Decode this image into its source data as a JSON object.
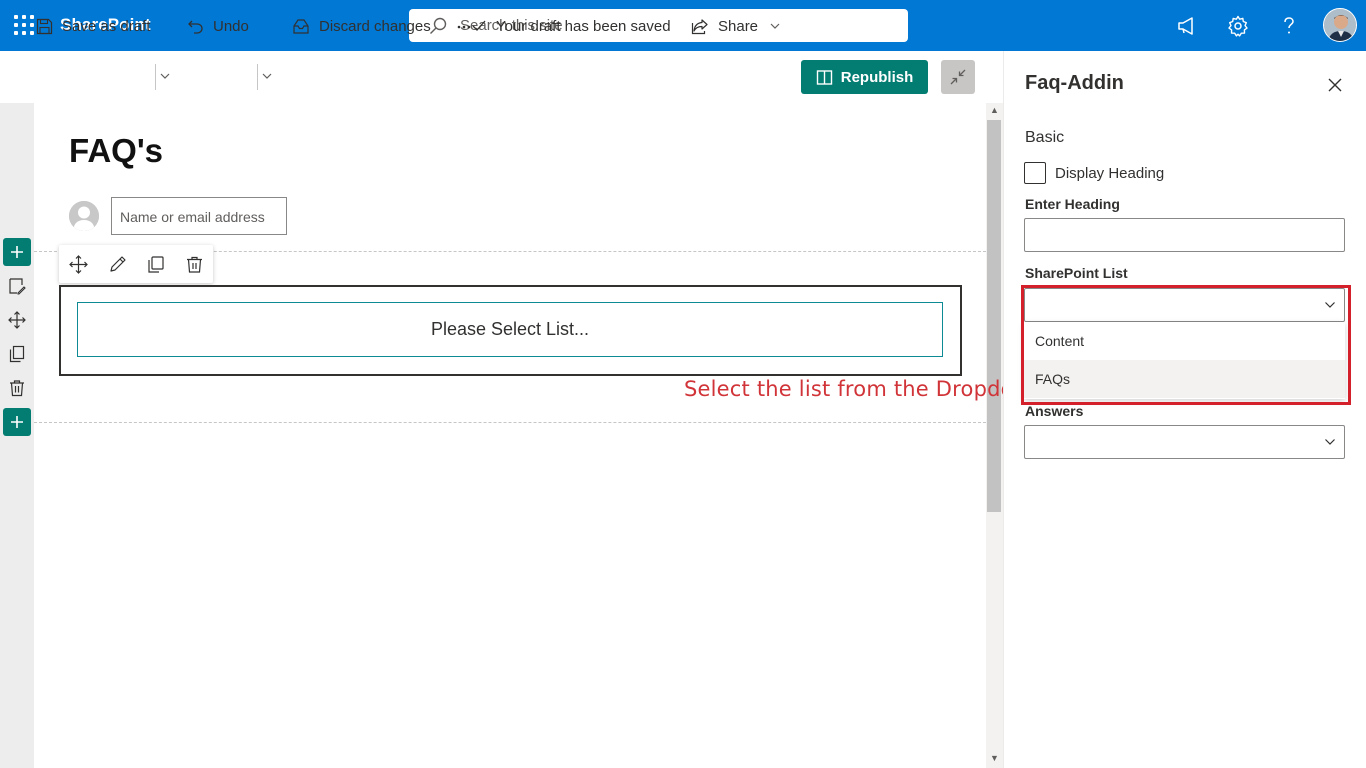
{
  "suitebar": {
    "brand": "SharePoint",
    "search_placeholder": "Search this site",
    "icons": [
      "waffle-icon",
      "search-icon",
      "megaphone-icon",
      "settings-gear-icon",
      "help-question-icon",
      "user-avatar"
    ],
    "accent": "#0078d4"
  },
  "commandbar": {
    "save_draft": "Save as draft",
    "undo": "Undo",
    "discard": "Discard changes",
    "status": "Your draft has been saved",
    "share": "Share",
    "republish": "Republish",
    "republish_color": "#037c72"
  },
  "page": {
    "title": "FAQ's",
    "author_placeholder": "Name or email address",
    "webpart_message": "Please Select List...",
    "annotation": "Select the list from the Dropdown",
    "annotation_color": "#d13438"
  },
  "pane": {
    "title": "Faq-Addin",
    "group": "Basic",
    "display_heading": "Display Heading",
    "display_heading_checked": false,
    "enter_heading_label": "Enter Heading",
    "enter_heading_value": "",
    "list_label": "SharePoint List",
    "list_selected": "",
    "list_options": [
      "Content",
      "FAQs"
    ],
    "answers_label": "Answers",
    "answers_selected": ""
  }
}
